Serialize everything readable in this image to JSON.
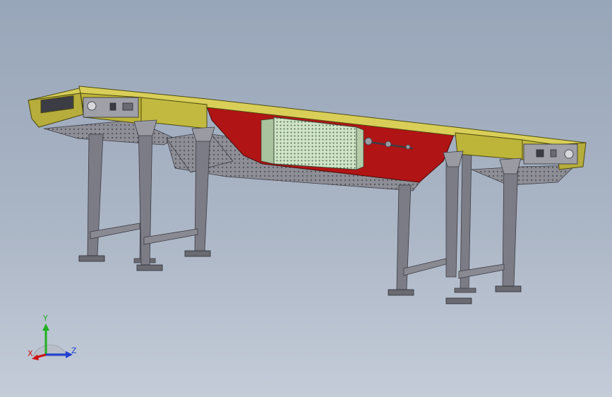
{
  "viewer": {
    "colors": {
      "background_top": "#98a6b9",
      "background_bottom": "#c4ccd8",
      "frame_yellow": "#bdb43a",
      "guard_red": "#b01414",
      "motor_green": "#cfe3c6",
      "leg_gray": "#7c7c86",
      "tray_gray": "#8c8c94"
    }
  },
  "triad": {
    "labels": {
      "x": "X",
      "y": "Y",
      "z": "Z"
    },
    "colors": {
      "x": "#d01010",
      "y": "#20b020",
      "z": "#2040d0"
    }
  }
}
